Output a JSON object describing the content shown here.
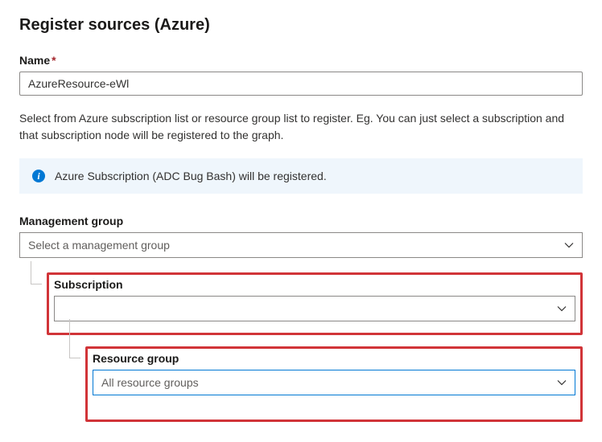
{
  "page_title": "Register sources (Azure)",
  "name_field": {
    "label": "Name",
    "value": "AzureResource-eWl"
  },
  "help_text": "Select from Azure subscription list or resource group list to register. Eg. You can just select a subscription and that subscription node will be registered to the graph.",
  "info_banner": {
    "text": "Azure Subscription (ADC Bug Bash) will be registered."
  },
  "management_group": {
    "label": "Management group",
    "placeholder": "Select a management group"
  },
  "subscription": {
    "label": "Subscription",
    "value": ""
  },
  "resource_group": {
    "label": "Resource group",
    "value": "All resource groups"
  }
}
